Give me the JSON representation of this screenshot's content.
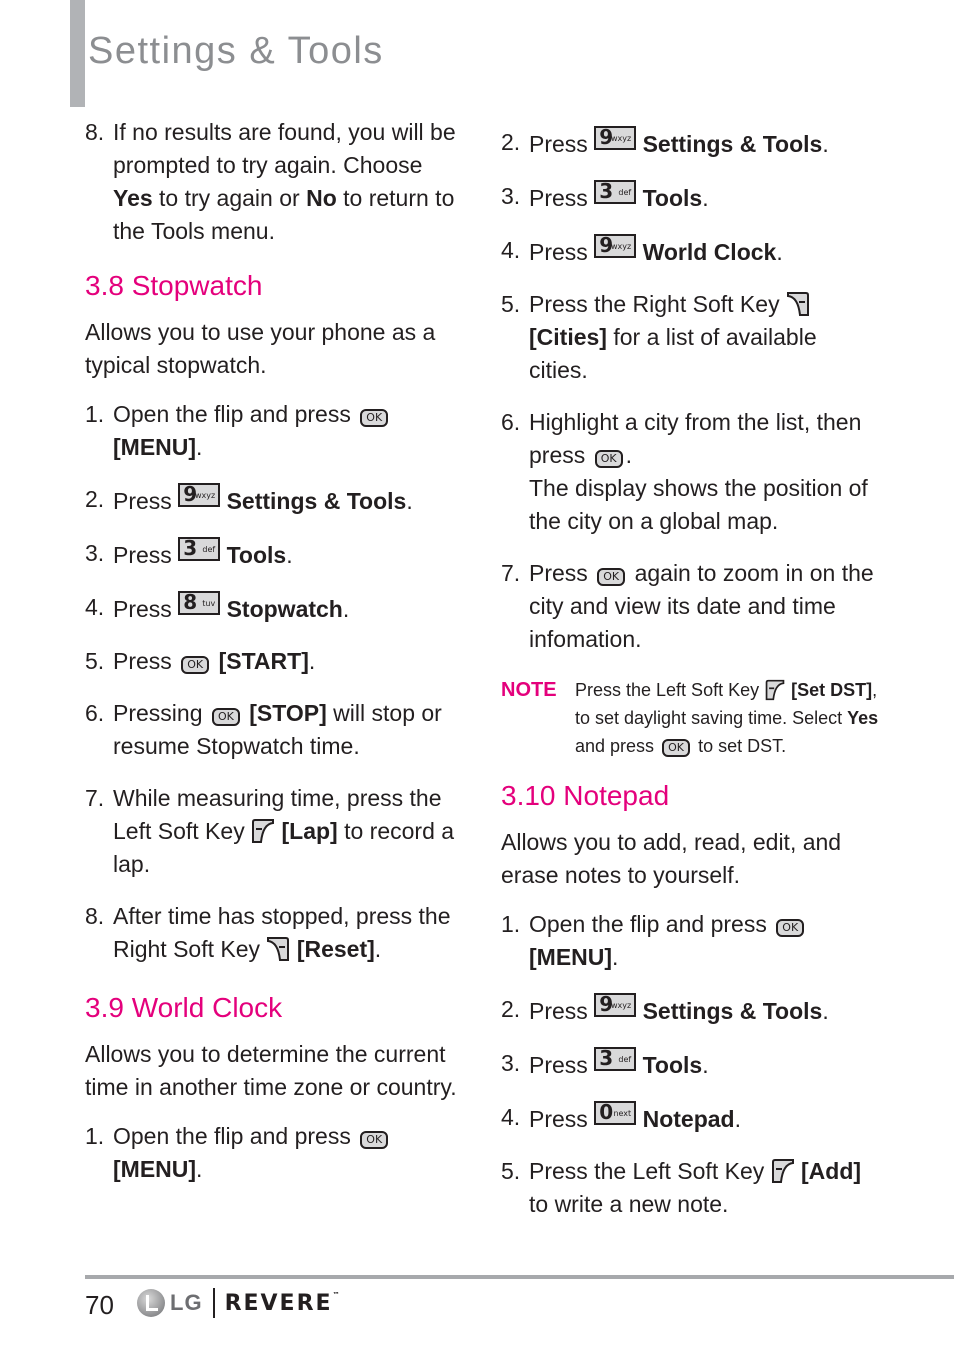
{
  "header": {
    "title": "Settings & Tools"
  },
  "left": {
    "intro_step": {
      "num": "8.",
      "t1": "If no results are found, you will be prompted to try again. Choose ",
      "b1": "Yes",
      "t2": " to try again or ",
      "b2": "No",
      "t3": " to return to the Tools menu."
    },
    "stopwatch": {
      "heading": "3.8 Stopwatch",
      "desc": "Allows you to use your phone as a typical stopwatch.",
      "steps": [
        {
          "num": "1.",
          "pre": "Open the flip and press",
          "key": "ok",
          "post": "",
          "bold": "[MENU]",
          "tail": "."
        },
        {
          "num": "2.",
          "pre": "Press",
          "key_big": "9",
          "key_small": "wxyz",
          "bold": "Settings & Tools",
          "tail": "."
        },
        {
          "num": "3.",
          "pre": "Press",
          "key_big": "3",
          "key_small": "def",
          "bold": "Tools",
          "tail": "."
        },
        {
          "num": "4.",
          "pre": "Press",
          "key_big": "8",
          "key_small": "tuv",
          "bold": "Stopwatch",
          "tail": "."
        },
        {
          "num": "5.",
          "pre": "Press",
          "bold": "[START]",
          "tail": "."
        },
        {
          "num": "6.",
          "pre": "Pressing",
          "bold": "[STOP]",
          "tail": " will stop or resume Stopwatch time."
        },
        {
          "num": "7.",
          "pre": "While measuring time, press the Left Soft Key",
          "bold": "[Lap]",
          "tail": " to record a lap."
        },
        {
          "num": "8.",
          "pre": "After time has stopped, press the Right Soft Key",
          "bold": "[Reset]",
          "tail": "."
        }
      ]
    },
    "world_clock": {
      "heading": "3.9 World Clock",
      "desc": "Allows you to determine the current time in another time zone or country.",
      "step1": {
        "num": "1.",
        "pre": "Open the flip and press",
        "bold": "[MENU]",
        "tail": "."
      }
    }
  },
  "right": {
    "world_clock_steps": [
      {
        "num": "2.",
        "pre": "Press",
        "key_big": "9",
        "key_small": "wxyz",
        "bold": "Settings & Tools",
        "tail": "."
      },
      {
        "num": "3.",
        "pre": "Press",
        "key_big": "3",
        "key_small": "def",
        "bold": "Tools",
        "tail": "."
      },
      {
        "num": "4.",
        "pre": "Press",
        "key_big": "9",
        "key_small": "wxyz",
        "bold": "World Clock",
        "tail": "."
      },
      {
        "num": "5.",
        "pre": "Press the Right Soft Key",
        "bold": "[Cities]",
        "tail": " for a list of available cities."
      },
      {
        "num": "6.",
        "pre": "Highlight a city from the list, then press",
        "tail": ".",
        "extra": "The display shows the position of the city on a global map."
      },
      {
        "num": "7.",
        "pre": "Press",
        "tail": " again to zoom in on the city and view its date and time infomation."
      }
    ],
    "note": {
      "label": "NOTE",
      "t1": "Press the Left Soft Key",
      "b1": "[Set DST]",
      "t2": ", to set daylight saving time. Select ",
      "b2": "Yes",
      "t3": " and press",
      "t4": " to set DST."
    },
    "notepad": {
      "heading": "3.10 Notepad",
      "desc": "Allows you to add, read, edit, and erase notes to yourself.",
      "steps": [
        {
          "num": "1.",
          "pre": "Open the flip and press",
          "bold": "[MENU]",
          "tail": "."
        },
        {
          "num": "2.",
          "pre": "Press",
          "key_big": "9",
          "key_small": "wxyz",
          "bold": "Settings & Tools",
          "tail": "."
        },
        {
          "num": "3.",
          "pre": "Press",
          "key_big": "3",
          "key_small": "def",
          "bold": "Tools",
          "tail": "."
        },
        {
          "num": "4.",
          "pre": "Press",
          "key_big": "0",
          "key_small": "next",
          "bold": "Notepad",
          "tail": "."
        },
        {
          "num": "5.",
          "pre": "Press the Left Soft Key",
          "bold": "[Add]",
          "tail": " to write a new note."
        }
      ]
    }
  },
  "keys": {
    "ok_label": "OK"
  },
  "footer": {
    "page_number": "70",
    "logo_text": "LG",
    "brand": "REVERE",
    "tm": "™"
  },
  "colors": {
    "accent": "#e4007c",
    "title_gray": "#8c8e91"
  }
}
